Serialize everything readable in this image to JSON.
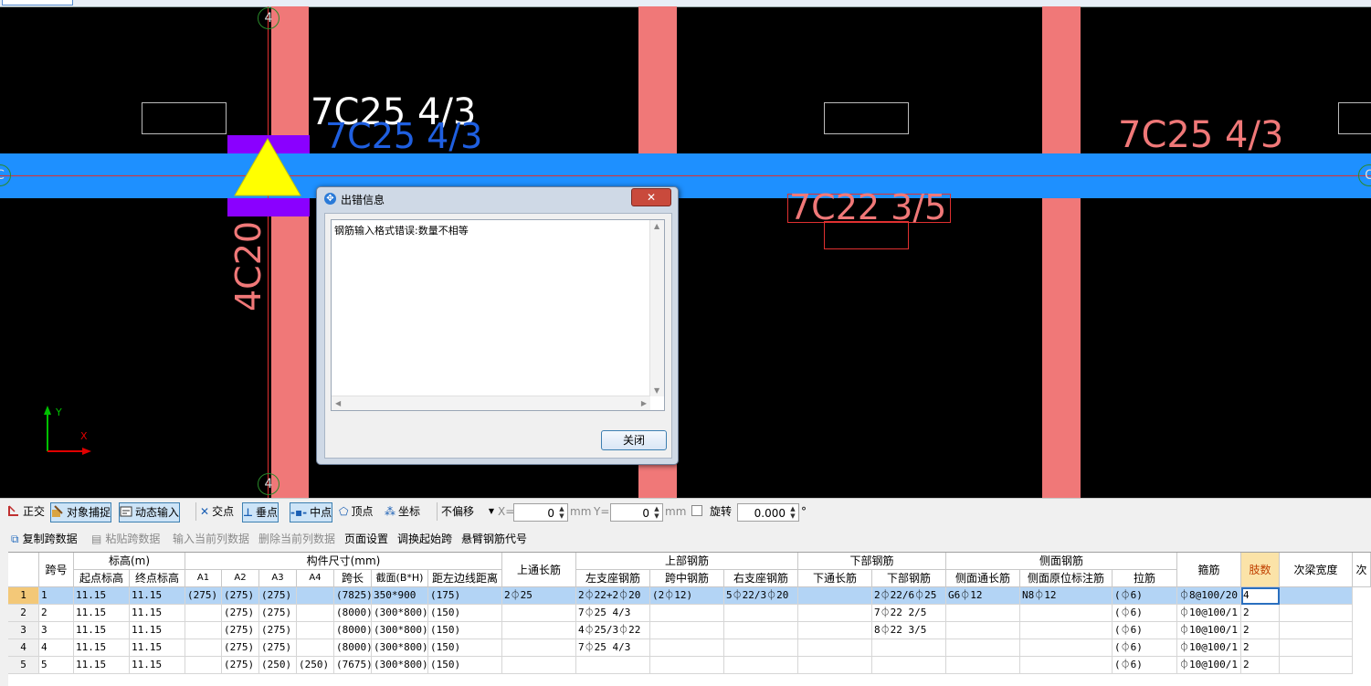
{
  "canvas": {
    "axis_labels": {
      "top_left": "4",
      "bottom_left": "4",
      "left_row": "C",
      "right_row": "C"
    },
    "beam_labels": [
      {
        "text": "7C25 4/3",
        "color": "#ffffff"
      },
      {
        "text": "7C25 4/3",
        "color": "#1f5fe0"
      },
      {
        "text": "7C25 4/3",
        "color": "#f07878"
      },
      {
        "text": "7C22 3/5",
        "color": "#f07878"
      },
      {
        "text": "4C20",
        "color": "#f07878"
      }
    ],
    "ucs": {
      "y": "Y",
      "x": "X"
    }
  },
  "dialog": {
    "title": "出错信息",
    "message": "钢筋输入格式错误:数量不相等",
    "close_label": "关闭",
    "close_x": "✕"
  },
  "toolbar1": {
    "ortho": "正交",
    "snap": "对象捕捉",
    "dynamic_input": "动态输入",
    "intersection": "交点",
    "perpendicular": "垂点",
    "midpoint": "中点",
    "vertex": "顶点",
    "coordinate": "坐标",
    "offset_mode": "不偏移",
    "x_label": "X=",
    "x_value": "0",
    "y_label": "Y=",
    "y_value": "0",
    "unit_mm": "mm",
    "rotate_label": "旋转",
    "rotate_value": "0.000",
    "degree": "°"
  },
  "toolbar2": {
    "copy_span": "复制跨数据",
    "paste_span": "粘贴跨数据",
    "input_col": "输入当前列数据",
    "delete_col": "删除当前列数据",
    "page_setup": "页面设置",
    "swap_start": "调换起始跨",
    "cantilever": "悬臂钢筋代号"
  },
  "table": {
    "group_headers": {
      "elevation": "标高(m)",
      "dims": "构件尺寸(mm)",
      "top_rebar": "上部钢筋",
      "bottom_rebar": "下部钢筋",
      "side_rebar": "侧面钢筋"
    },
    "headers": {
      "span": "跨号",
      "start_elev": "起点标高",
      "end_elev": "终点标高",
      "a1": "A1",
      "a2": "A2",
      "a3": "A3",
      "a4": "A4",
      "span_len": "跨长",
      "section": "截面(B*H)",
      "dist_left": "距左边线距离",
      "top_through": "上通长筋",
      "left_support": "左支座钢筋",
      "mid_span": "跨中钢筋",
      "right_support": "右支座钢筋",
      "bottom_through": "下通长筋",
      "bottom_rebar": "下部钢筋",
      "side_through": "侧面通长筋",
      "side_in_situ": "侧面原位标注筋",
      "tie": "拉筋",
      "stirrup": "箍筋",
      "legs": "肢数",
      "secondary_width": "次梁宽度",
      "more": "次"
    },
    "rows": [
      {
        "n": "1",
        "span": "1",
        "start": "11.15",
        "end": "11.15",
        "a1": "(275)",
        "a2": "(275)",
        "a3": "(275)",
        "a4": "",
        "len": "(7825)",
        "sec": "350*900",
        "dist": "(175)",
        "top": "2⏀25",
        "ls": "2⏀22+2⏀20",
        "mid": "(2⏀12)",
        "rs": "5⏀22/3⏀20",
        "bt": "",
        "bot": "2⏀22/6⏀25",
        "st": "G6⏀12",
        "sis": "N8⏀12",
        "tie": "(⏀6)",
        "stir": "⏀8@100/20",
        "legs": "4",
        "sw": ""
      },
      {
        "n": "2",
        "span": "2",
        "start": "11.15",
        "end": "11.15",
        "a1": "",
        "a2": "(275)",
        "a3": "(275)",
        "a4": "",
        "len": "(8000)",
        "sec": "(300*800)",
        "dist": "(150)",
        "top": "",
        "ls": "7⏀25 4/3",
        "mid": "",
        "rs": "",
        "bt": "",
        "bot": "7⏀22 2/5",
        "st": "",
        "sis": "",
        "tie": "(⏀6)",
        "stir": "⏀10@100/1",
        "legs": "2",
        "sw": ""
      },
      {
        "n": "3",
        "span": "3",
        "start": "11.15",
        "end": "11.15",
        "a1": "",
        "a2": "(275)",
        "a3": "(275)",
        "a4": "",
        "len": "(8000)",
        "sec": "(300*800)",
        "dist": "(150)",
        "top": "",
        "ls": "4⏀25/3⏀22",
        "mid": "",
        "rs": "",
        "bt": "",
        "bot": "8⏀22 3/5",
        "st": "",
        "sis": "",
        "tie": "(⏀6)",
        "stir": "⏀10@100/1",
        "legs": "2",
        "sw": ""
      },
      {
        "n": "4",
        "span": "4",
        "start": "11.15",
        "end": "11.15",
        "a1": "",
        "a2": "(275)",
        "a3": "(275)",
        "a4": "",
        "len": "(8000)",
        "sec": "(300*800)",
        "dist": "(150)",
        "top": "",
        "ls": "7⏀25 4/3",
        "mid": "",
        "rs": "",
        "bt": "",
        "bot": "",
        "st": "",
        "sis": "",
        "tie": "(⏀6)",
        "stir": "⏀10@100/1",
        "legs": "2",
        "sw": ""
      },
      {
        "n": "5",
        "span": "5",
        "start": "11.15",
        "end": "11.15",
        "a1": "",
        "a2": "(275)",
        "a3": "(250)",
        "a4": "(250)",
        "len": "(7675)",
        "sec": "(300*800)",
        "dist": "(150)",
        "top": "",
        "ls": "",
        "mid": "",
        "rs": "",
        "bt": "",
        "bot": "",
        "st": "",
        "sis": "",
        "tie": "(⏀6)",
        "stir": "⏀10@100/1",
        "legs": "2",
        "sw": ""
      }
    ]
  }
}
